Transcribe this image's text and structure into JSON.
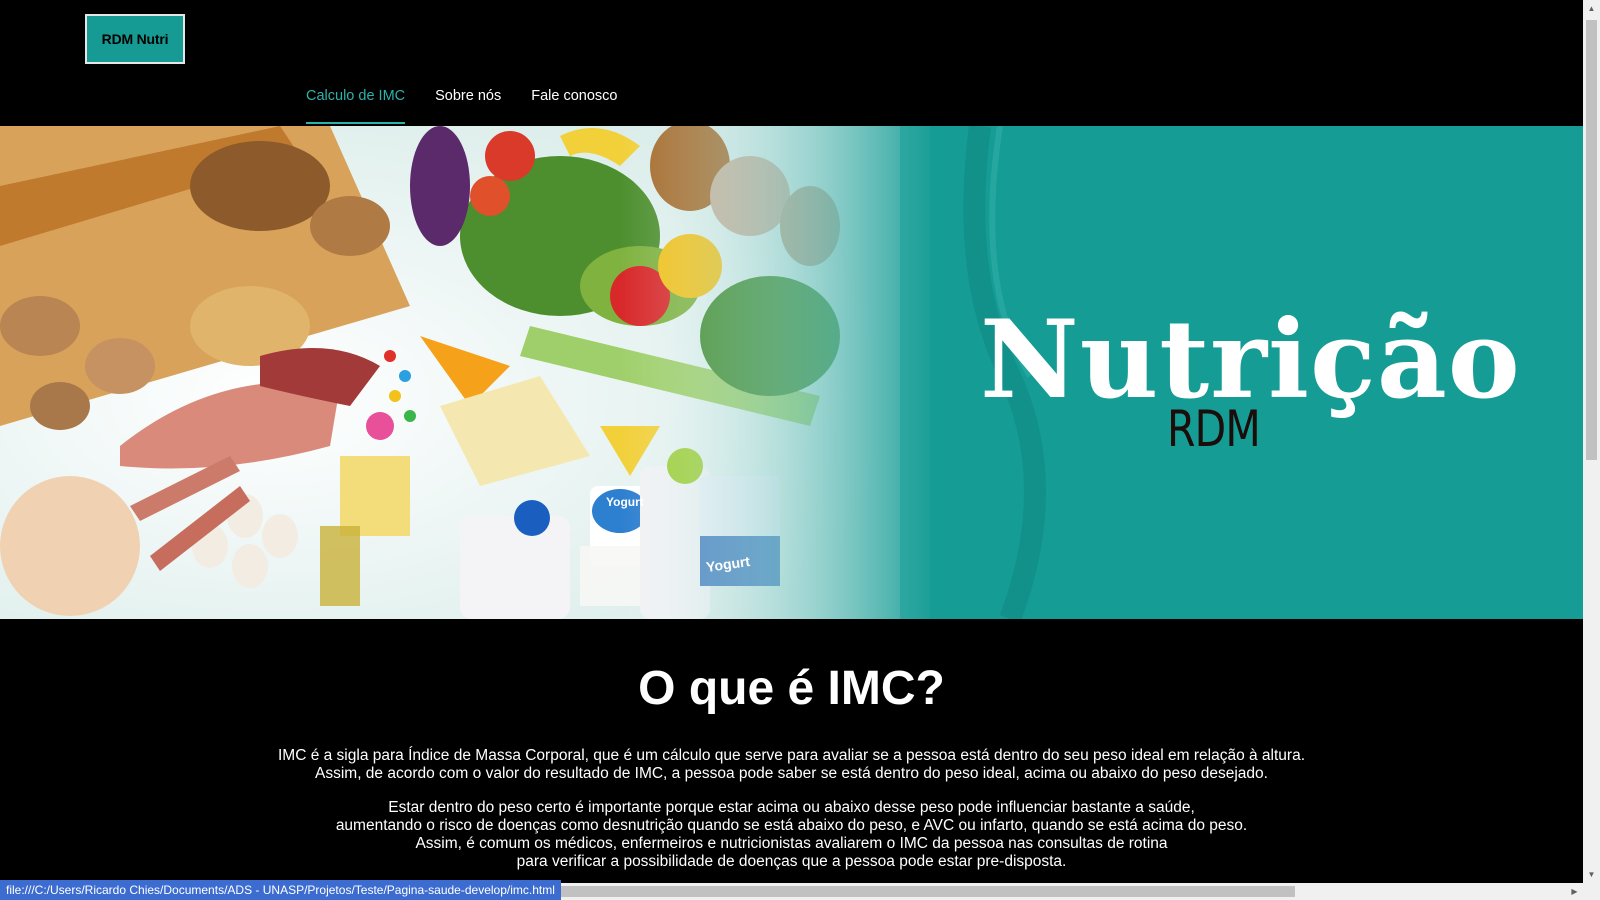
{
  "header": {
    "logo_label": "RDM Nutri",
    "nav": [
      {
        "label": "Calculo de IMC",
        "active": true
      },
      {
        "label": "Sobre nós",
        "active": false
      },
      {
        "label": "Fale conosco",
        "active": false
      }
    ],
    "accent_color": "#2bb3a9"
  },
  "banner": {
    "title": "Nutrição",
    "subtitle": "RDM",
    "yogurt_label_1": "Yogurt",
    "yogurt_label_2": "Yogurt",
    "background_color": "#159c95"
  },
  "content": {
    "title": "O que é IMC?",
    "paragraph1": [
      "IMC é a sigla para Índice de Massa Corporal, que é um cálculo que serve para avaliar se a pessoa está dentro do seu peso ideal em relação à altura.",
      "Assim, de acordo com o valor do resultado de IMC, a pessoa pode saber se está dentro do peso ideal, acima ou abaixo do peso desejado."
    ],
    "paragraph2": [
      "Estar dentro do peso certo é importante porque estar acima ou abaixo desse peso pode influenciar bastante a saúde,",
      "aumentando o risco de doenças como desnutrição quando se está abaixo do peso, e AVC ou infarto, quando se está acima do peso.",
      "Assim, é comum os médicos, enfermeiros e nutricionistas avaliarem o IMC da pessoa nas consultas de rotina",
      "para verificar a possibilidade de doenças que a pessoa pode estar pre-disposta."
    ]
  },
  "status_bar": {
    "url": "file:///C:/Users/Ricardo Chies/Documents/ADS - UNASP/Projetos/Teste/Pagina-saude-develop/imc.html"
  }
}
